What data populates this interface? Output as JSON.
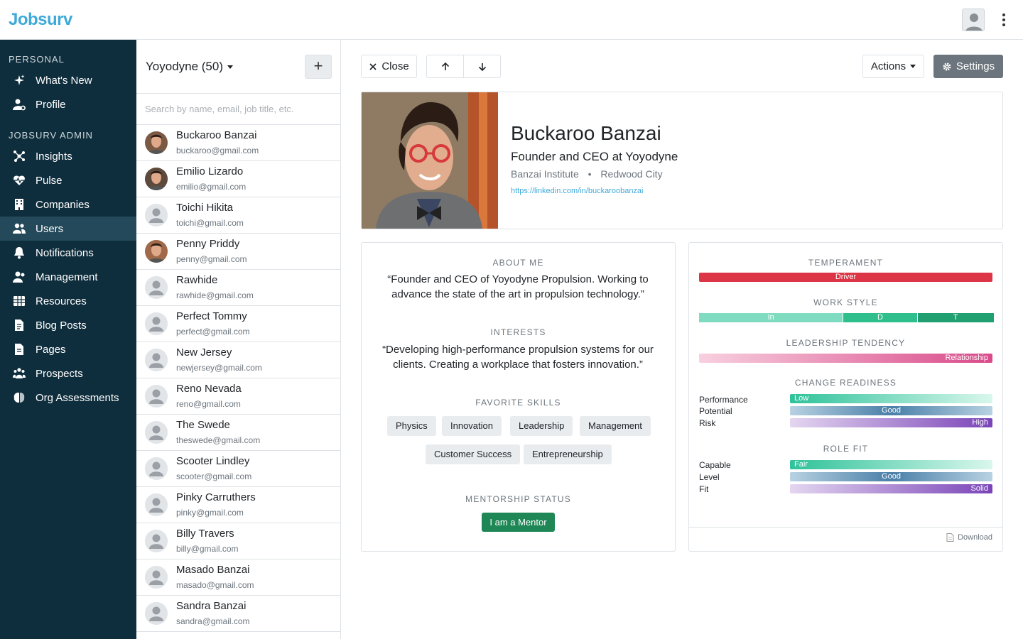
{
  "app": {
    "name": "Jobsurv"
  },
  "sidebar": {
    "section_personal": "PERSONAL",
    "section_admin": "JOBSURV ADMIN",
    "items": [
      {
        "label": "What's New",
        "icon": "sparkles-icon"
      },
      {
        "label": "Profile",
        "icon": "user-gear-icon"
      },
      {
        "label": "Insights",
        "icon": "network-icon"
      },
      {
        "label": "Pulse",
        "icon": "heart-pulse-icon"
      },
      {
        "label": "Companies",
        "icon": "building-icon"
      },
      {
        "label": "Users",
        "icon": "users-icon",
        "active": true
      },
      {
        "label": "Notifications",
        "icon": "bell-icon"
      },
      {
        "label": "Management",
        "icon": "user-group-icon"
      },
      {
        "label": "Resources",
        "icon": "grid-icon"
      },
      {
        "label": "Blog Posts",
        "icon": "file-icon"
      },
      {
        "label": "Pages",
        "icon": "page-icon"
      },
      {
        "label": "Prospects",
        "icon": "people-icon"
      },
      {
        "label": "Org Assessments",
        "icon": "brain-icon"
      }
    ]
  },
  "userlist": {
    "company_label": "Yoyodyne (50)",
    "add_label": "+",
    "search_placeholder": "Search by name, email, job title, etc.",
    "users": [
      {
        "name": "Buckaroo Banzai",
        "email": "buckaroo@gmail.com"
      },
      {
        "name": "Emilio Lizardo",
        "email": "emilio@gmail.com"
      },
      {
        "name": "Toichi Hikita",
        "email": "toichi@gmail.com"
      },
      {
        "name": "Penny Priddy",
        "email": "penny@gmail.com"
      },
      {
        "name": "Rawhide",
        "email": "rawhide@gmail.com"
      },
      {
        "name": "Perfect Tommy",
        "email": "perfect@gmail.com"
      },
      {
        "name": "New Jersey",
        "email": "newjersey@gmail.com"
      },
      {
        "name": "Reno Nevada",
        "email": "reno@gmail.com"
      },
      {
        "name": "The Swede",
        "email": "theswede@gmail.com"
      },
      {
        "name": "Scooter Lindley",
        "email": "scooter@gmail.com"
      },
      {
        "name": "Pinky Carruthers",
        "email": "pinky@gmail.com"
      },
      {
        "name": "Billy Travers",
        "email": "billy@gmail.com"
      },
      {
        "name": "Masado Banzai",
        "email": "masado@gmail.com"
      },
      {
        "name": "Sandra Banzai",
        "email": "sandra@gmail.com"
      }
    ]
  },
  "toolbar": {
    "close_label": "Close",
    "actions_label": "Actions",
    "settings_label": "Settings"
  },
  "profile": {
    "name": "Buckaroo Banzai",
    "title": "Founder and CEO at Yoyodyne",
    "org": "Banzai Institute",
    "separator": "•",
    "city": "Redwood City",
    "link": "https://linkedin.com/in/buckaroobanzai"
  },
  "about": {
    "about_label": "ABOUT ME",
    "about_text": "“Founder and CEO of Yoyodyne Propulsion. Working to advance the state of the art in propulsion technology.”",
    "interests_label": "INTERESTS",
    "interests_text": "“Developing high-performance propulsion systems for our clients. Creating a workplace that fosters innovation.”",
    "skills_label": "FAVORITE SKILLS",
    "skills": [
      "Physics",
      "Innovation",
      "Leadership",
      "Management",
      "Customer Success",
      "Entrepreneurship"
    ],
    "mentorship_label": "MENTORSHIP STATUS",
    "mentor_button": "I am a Mentor"
  },
  "assessment": {
    "temperament_label": "TEMPERAMENT",
    "temperament_value": "Driver",
    "workstyle_label": "WORK STYLE",
    "workstyle_segments": [
      {
        "label": "In",
        "share": 0.49
      },
      {
        "label": "D",
        "share": 0.25
      },
      {
        "label": "T",
        "share": 0.26
      }
    ],
    "leadership_label": "LEADERSHIP TENDENCY",
    "leadership_value": "Relationship",
    "change_label": "CHANGE READINESS",
    "change_rows": [
      {
        "label": "Performance",
        "value": "Low"
      },
      {
        "label": "Potential",
        "value": "Good"
      },
      {
        "label": "Risk",
        "value": "High"
      }
    ],
    "rolefit_label": "ROLE FIT",
    "rolefit_rows": [
      {
        "label": "Capable",
        "value": "Fair"
      },
      {
        "label": "Level",
        "value": "Good"
      },
      {
        "label": "Fit",
        "value": "Solid"
      }
    ],
    "download_label": "Download"
  },
  "colors": {
    "sidebar_bg": "#0f2e3d",
    "brand": "#3fa9d8",
    "mentor_green": "#1e8755",
    "temperament_red": "#dc3545"
  }
}
